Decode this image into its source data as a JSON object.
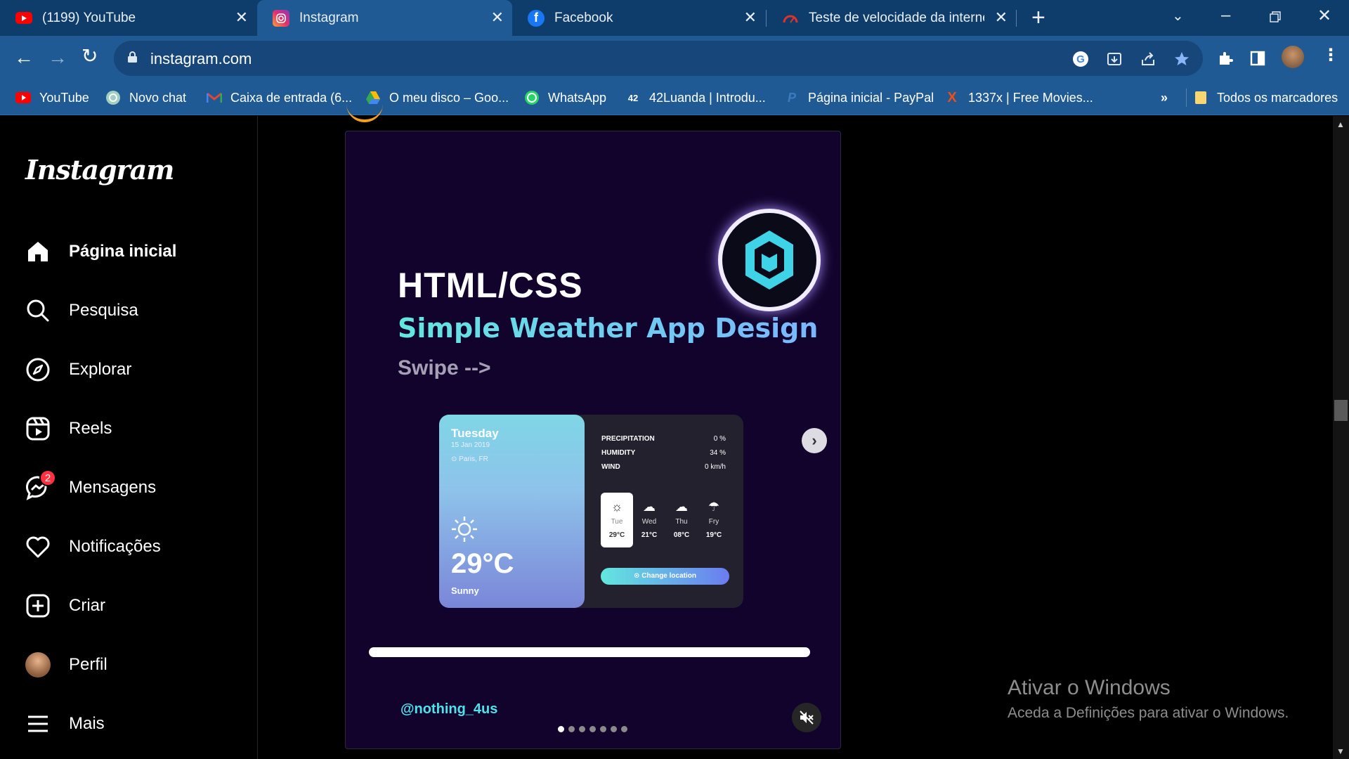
{
  "tabs": [
    {
      "title": "(1199) YouTube",
      "icon": "youtube-icon"
    },
    {
      "title": "Instagram",
      "icon": "instagram-icon",
      "active": true
    },
    {
      "title": "Facebook",
      "icon": "facebook-icon"
    },
    {
      "title": "Teste de velocidade da internet",
      "icon": "speedtest-icon"
    }
  ],
  "address": {
    "url": "instagram.com"
  },
  "bookmarks": [
    {
      "label": "YouTube",
      "icon": "youtube-icon"
    },
    {
      "label": "Novo chat",
      "icon": "chatgpt-icon"
    },
    {
      "label": "Caixa de entrada (6...",
      "icon": "gmail-icon"
    },
    {
      "label": "O meu disco – Goo...",
      "icon": "google-drive-icon"
    },
    {
      "label": "WhatsApp",
      "icon": "whatsapp-icon"
    },
    {
      "label": "42Luanda | Introdu...",
      "icon": "42-icon"
    },
    {
      "label": "Página inicial - PayPal",
      "icon": "paypal-icon"
    },
    {
      "label": "1337x | Free Movies...",
      "icon": "1337x-icon"
    }
  ],
  "bookmarks_more": "»",
  "bookmarks_folder": "Todos os marcadores",
  "sidebar": {
    "logo": "Instagram",
    "items": [
      {
        "label": "Página inicial",
        "icon": "home-icon"
      },
      {
        "label": "Pesquisa",
        "icon": "search-icon"
      },
      {
        "label": "Explorar",
        "icon": "compass-icon"
      },
      {
        "label": "Reels",
        "icon": "reels-icon"
      },
      {
        "label": "Mensagens",
        "icon": "messenger-icon",
        "badge": "2"
      },
      {
        "label": "Notificações",
        "icon": "heart-icon"
      },
      {
        "label": "Criar",
        "icon": "plus-square-icon"
      },
      {
        "label": "Perfil",
        "icon": "avatar"
      },
      {
        "label": "Mais",
        "icon": "menu-icon"
      }
    ]
  },
  "post": {
    "title": "HTML/CSS",
    "subtitle": "Simple Weather App Design",
    "swipe": "Swipe -->",
    "handle": "@nothing_4us",
    "weather": {
      "day": "Tuesday",
      "date": "15 Jan 2019",
      "location": "Paris, FR",
      "temp": "29°C",
      "condition": "Sunny",
      "stats": [
        {
          "label": "PRECIPITATION",
          "value": "0 %"
        },
        {
          "label": "HUMIDITY",
          "value": "34 %"
        },
        {
          "label": "WIND",
          "value": "0 km/h"
        }
      ],
      "days": [
        {
          "name": "Tue",
          "temp": "29°C",
          "icon": "sun-icon"
        },
        {
          "name": "Wed",
          "temp": "21°C",
          "icon": "cloud-icon"
        },
        {
          "name": "Thu",
          "temp": "08°C",
          "icon": "snow-cloud-icon"
        },
        {
          "name": "Fry",
          "temp": "19°C",
          "icon": "rain-cloud-icon"
        }
      ],
      "button": "Change location"
    },
    "carousel": {
      "total": 7,
      "current": 1
    }
  },
  "watermark": {
    "line1": "Ativar o Windows",
    "line2": "Aceda a Definições para ativar o Windows."
  },
  "colors": {
    "accent": "#62e7df",
    "tabbar": "#0f3d6b",
    "toolbar": "#1f5a94",
    "badge": "#ff3040"
  }
}
